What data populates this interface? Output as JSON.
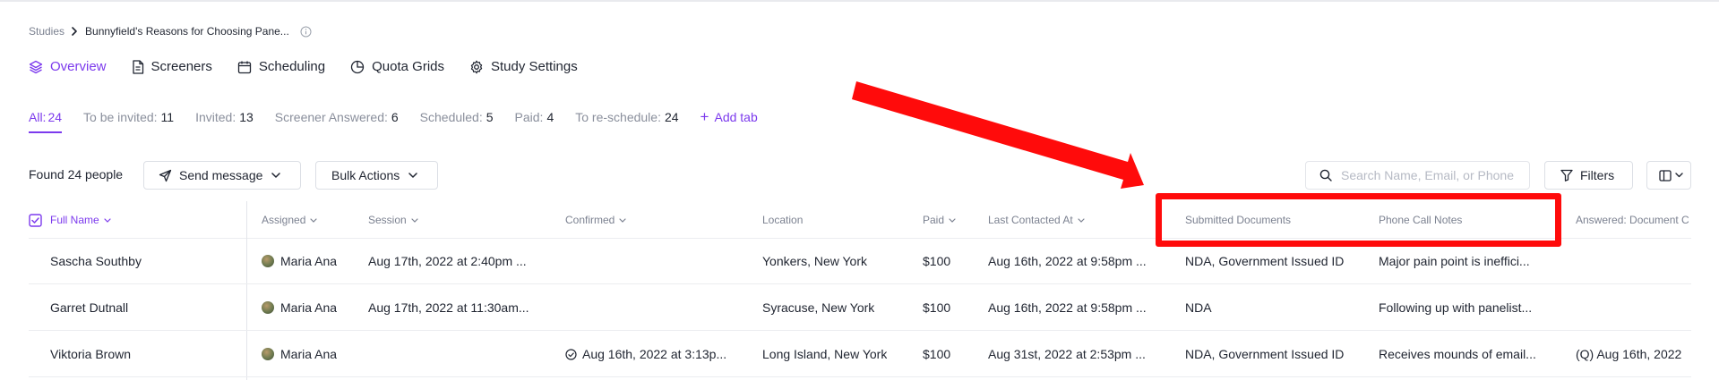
{
  "breadcrumb": {
    "root": "Studies",
    "current": "Bunnyfield's Reasons for Choosing Pane..."
  },
  "nav_tabs": [
    {
      "label": "Overview",
      "icon": "layers-icon",
      "active": true
    },
    {
      "label": "Screeners",
      "icon": "document-icon",
      "active": false
    },
    {
      "label": "Scheduling",
      "icon": "calendar-icon",
      "active": false
    },
    {
      "label": "Quota Grids",
      "icon": "pie-chart-icon",
      "active": false
    },
    {
      "label": "Study Settings",
      "icon": "gear-icon",
      "active": false
    }
  ],
  "filter_tabs": [
    {
      "label": "All:",
      "count": "24",
      "active": true
    },
    {
      "label": "To be invited:",
      "count": "11"
    },
    {
      "label": "Invited:",
      "count": "13"
    },
    {
      "label": "Screener Answered:",
      "count": "6"
    },
    {
      "label": "Scheduled:",
      "count": "5"
    },
    {
      "label": "Paid:",
      "count": "4"
    },
    {
      "label": "To re-schedule:",
      "count": "24"
    }
  ],
  "add_tab_label": "Add tab",
  "toolbar": {
    "found_text": "Found 24 people",
    "send_message_label": "Send message",
    "bulk_actions_label": "Bulk Actions",
    "search_placeholder": "Search Name, Email, or Phone",
    "filters_label": "Filters"
  },
  "table": {
    "columns": {
      "full_name": "Full Name",
      "assigned": "Assigned",
      "session": "Session",
      "confirmed": "Confirmed",
      "location": "Location",
      "paid": "Paid",
      "last_contacted": "Last Contacted At",
      "submitted_documents": "Submitted Documents",
      "phone_call_notes": "Phone Call Notes",
      "answered": "Answered: Document C"
    },
    "rows": [
      {
        "full_name": "Sascha Southby",
        "assigned": "Maria Ana",
        "session": "Aug 17th, 2022 at 2:40pm ...",
        "confirmed": "",
        "location": "Yonkers, New York",
        "paid": "$100",
        "last_contacted": "Aug 16th, 2022 at 9:58pm ...",
        "submitted_documents": "NDA, Government Issued ID",
        "phone_call_notes": "Major pain point is ineffici...",
        "answered": ""
      },
      {
        "full_name": "Garret Dutnall",
        "assigned": "Maria Ana",
        "session": "Aug 17th, 2022 at 11:30am...",
        "confirmed": "",
        "location": "Syracuse, New York",
        "paid": "$100",
        "last_contacted": "Aug 16th, 2022 at 9:58pm ...",
        "submitted_documents": "NDA",
        "phone_call_notes": "Following up with panelist...",
        "answered": ""
      },
      {
        "full_name": "Viktoria Brown",
        "assigned": "Maria Ana",
        "session": "",
        "confirmed": "Aug 16th, 2022 at 3:13p...",
        "location": "Long Island, New York",
        "paid": "$100",
        "last_contacted": "Aug 31st, 2022 at 2:53pm ...",
        "submitted_documents": "NDA, Government Issued ID",
        "phone_call_notes": "Receives mounds of email...",
        "answered": "(Q) Aug 16th, 2022"
      }
    ]
  },
  "colors": {
    "accent": "#7c3aed",
    "annotation": "#ff0b0b",
    "muted_text": "#7b8190",
    "border": "#dcdfe5"
  }
}
